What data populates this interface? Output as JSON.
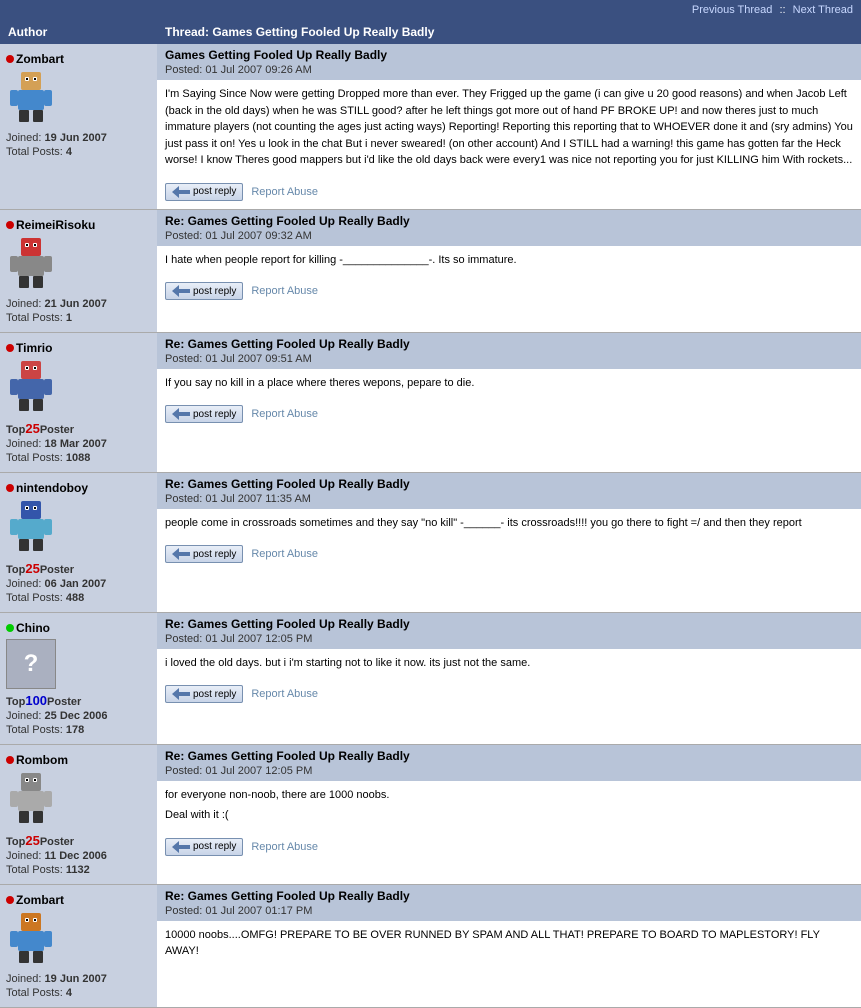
{
  "nav": {
    "previous_label": "Previous Thread",
    "next_label": "Next Thread",
    "separator": "::"
  },
  "header": {
    "author_col": "Author",
    "thread_col": "Thread: Games Getting Fooled Up Really Badly"
  },
  "posts": [
    {
      "id": "post-1",
      "author": {
        "username": "Zombart",
        "online": false,
        "joined": "19 Jun 2007",
        "total_posts": "4",
        "badge": null,
        "avatar_type": "roblox1"
      },
      "title": "Games Getting Fooled Up Really Badly",
      "date": "Posted: 01 Jul 2007 09:26 AM",
      "body": "I'm Saying Since Now were getting Dropped more than ever. They Frigged up the game (i can give u 20 good reasons) and when Jacob Left (back in the old days) when he was STILL good? after he left things got more out of hand PF BROKE UP! and now theres just to much immature players (not counting the ages just acting ways) Reporting! Reporting this reporting that to WHOEVER done it and (sry admins) You just pass it on! Yes u look in the chat But i never sweared! (on other account) And I STILL had a warning! this game has gotten far the Heck worse! I know Theres good mappers but i'd like the old days back were every1 was nice not reporting you for just KILLING him With rockets...",
      "has_reply": true,
      "has_report": true
    },
    {
      "id": "post-2",
      "author": {
        "username": "ReimeiRisoku",
        "online": false,
        "joined": "21 Jun 2007",
        "total_posts": "1",
        "badge": null,
        "avatar_type": "roblox2"
      },
      "title": "Re: Games Getting Fooled Up Really Badly",
      "date": "Posted: 01 Jul 2007 09:32 AM",
      "body": "I hate when people report for killing -______________-. Its so immature.",
      "has_reply": true,
      "has_report": true
    },
    {
      "id": "post-3",
      "author": {
        "username": "Timrio",
        "online": false,
        "joined": "18 Mar 2007",
        "total_posts": "1088",
        "badge": "top25",
        "avatar_type": "roblox3"
      },
      "title": "Re: Games Getting Fooled Up Really Badly",
      "date": "Posted: 01 Jul 2007 09:51 AM",
      "body": "If you say no kill in a place where theres wepons, pepare to die.",
      "has_reply": true,
      "has_report": true
    },
    {
      "id": "post-4",
      "author": {
        "username": "nintendoboy",
        "online": false,
        "joined": "06 Jan 2007",
        "total_posts": "488",
        "badge": "top25",
        "avatar_type": "roblox4"
      },
      "title": "Re: Games Getting Fooled Up Really Badly",
      "date": "Posted: 01 Jul 2007 11:35 AM",
      "body": "people come in crossroads sometimes and they say \"no kill\" -______- its crossroads!!!! you go there to fight =/ and then they report",
      "has_reply": true,
      "has_report": true
    },
    {
      "id": "post-5",
      "author": {
        "username": "Chino",
        "online": true,
        "joined": "25 Dec 2006",
        "total_posts": "178",
        "badge": "top100",
        "avatar_type": "question"
      },
      "title": "Re: Games Getting Fooled Up Really Badly",
      "date": "Posted: 01 Jul 2007 12:05 PM",
      "body": "i loved the old days. but i i'm starting not to like it now. its just not the same.",
      "has_reply": true,
      "has_report": true
    },
    {
      "id": "post-6",
      "author": {
        "username": "Rombom",
        "online": false,
        "joined": "11 Dec 2006",
        "total_posts": "1132",
        "badge": "top25",
        "avatar_type": "roblox5"
      },
      "title": "Re: Games Getting Fooled Up Really Badly",
      "date": "Posted: 01 Jul 2007 12:05 PM",
      "body": "for everyone non-noob, there are 1000 noobs.\nDeal with it :(",
      "has_reply": true,
      "has_report": true
    },
    {
      "id": "post-7",
      "author": {
        "username": "Zombart",
        "online": false,
        "joined": "19 Jun 2007",
        "total_posts": "4",
        "badge": null,
        "avatar_type": "roblox6"
      },
      "title": "Re: Games Getting Fooled Up Really Badly",
      "date": "Posted: 01 Jul 2007 01:17 PM",
      "body": "10000 noobs....OMFG! PREPARE TO BE OVER RUNNED BY SPAM AND ALL THAT! PREPARE TO BOARD TO MAPLESTORY! FLY AWAY!",
      "has_reply": false,
      "has_report": false
    }
  ],
  "labels": {
    "reply_button": "post reply",
    "report_link": "Report Abuse",
    "joined_label": "Joined:",
    "posts_label": "Total Posts:",
    "top25_text": "Top",
    "top25_num": "25",
    "top25_suffix": "Poster",
    "top100_text": "Top",
    "top100_num": "100",
    "top100_suffix": "Poster"
  }
}
